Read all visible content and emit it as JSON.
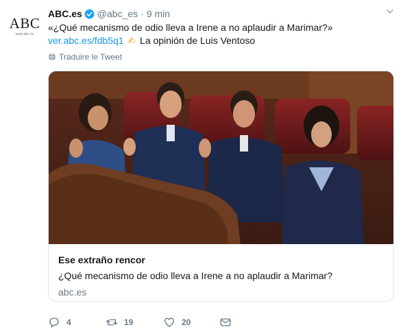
{
  "avatar": {
    "logo_text": "ABC",
    "logo_subtext": "www.abc.es",
    "icon": "abc-logo"
  },
  "header": {
    "display_name": "ABC.es",
    "handle": "@abc_es",
    "separator": "·",
    "timestamp": "9 min",
    "verified_icon": "verified-badge-icon",
    "menu_icon": "chevron-down-icon"
  },
  "tweet": {
    "text_line1": "«¿Qué mecanismo de odio lleva a Irene a no aplaudir a Marimar?»",
    "link": "ver.abc.es/fdb5q1",
    "emoji": "✍",
    "text_line2_rest": "La opinión de Luis Ventoso"
  },
  "translate": {
    "label": "Traduire le Tweet",
    "icon": "globe-icon"
  },
  "card": {
    "title": "Ese extraño rencor",
    "description": "¿Qué mecanismo de odio lleva a Irene a no aplaudir a Marimar?",
    "domain": "abc.es"
  },
  "actions": {
    "reply_count": "4",
    "retweet_count": "19",
    "like_count": "20",
    "reply_icon": "reply-icon",
    "retweet_icon": "retweet-icon",
    "like_icon": "heart-icon",
    "dm_icon": "envelope-icon"
  },
  "colors": {
    "link": "#1b95e0",
    "muted": "#657786",
    "text": "#14171a",
    "border": "#e1e8ed",
    "verified": "#1da1f2"
  }
}
